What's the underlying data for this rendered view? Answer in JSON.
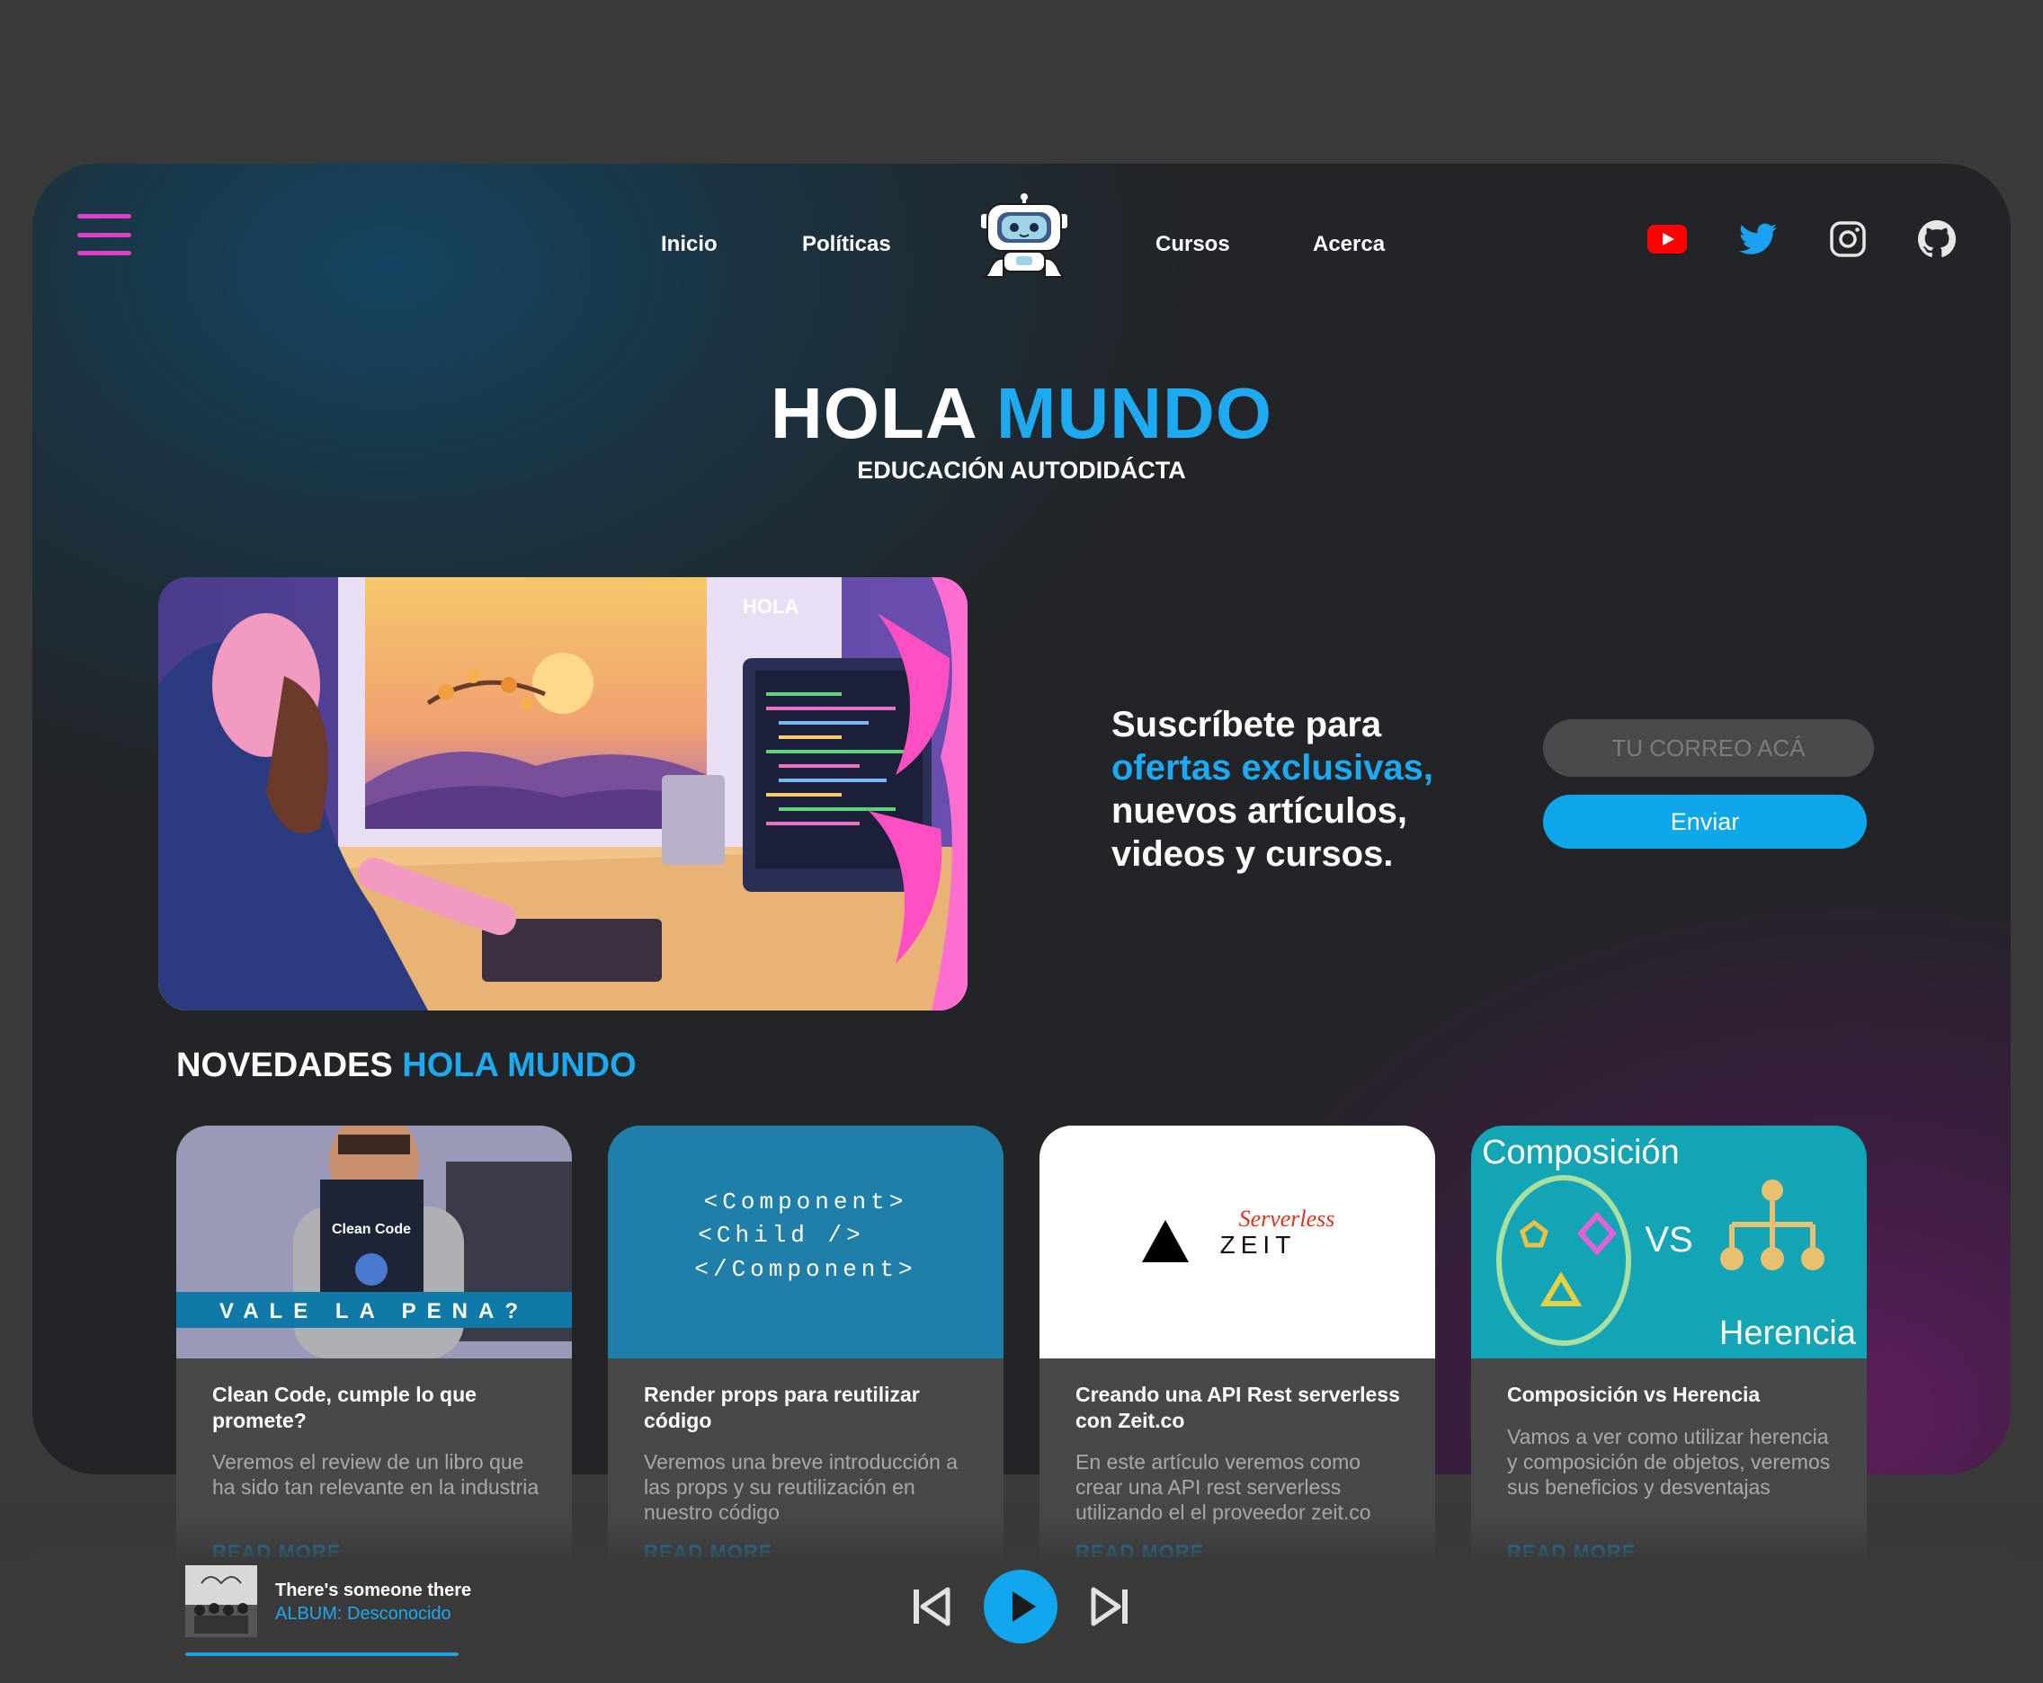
{
  "nav": {
    "items": [
      "Inicio",
      "Políticas",
      "Cursos",
      "Acerca"
    ],
    "social": [
      "youtube-icon",
      "twitter-icon",
      "instagram-icon",
      "github-icon"
    ]
  },
  "hero": {
    "title_part1": "HOLA",
    "title_part2": "MUNDO",
    "subtitle": "EDUCACIÓN AUTODIDÁCTA"
  },
  "illustration": {
    "brand_mark": "HOLA"
  },
  "subscribe": {
    "line1": "Suscríbete para",
    "line2": "ofertas exclusivas,",
    "line3": "nuevos artículos,",
    "line4": "videos y cursos.",
    "placeholder": "TU CORREO ACÁ",
    "button": "Enviar"
  },
  "news": {
    "title_part1": "NOVEDADES",
    "title_part2": "HOLA MUNDO",
    "cards": [
      {
        "title": "Clean Code, cumple lo que promete?",
        "desc": "Veremos el review de un libro que ha sido tan relevante en la industria",
        "more": "READ MORE",
        "img_book": "Clean Code",
        "img_banner": "VALE LA PENA?"
      },
      {
        "title": "Render props para reutilizar código",
        "desc": "Veremos una breve introducción a las props y su reutilización en nuestro código",
        "more": "READ MORE",
        "img_lines": [
          "<Component>",
          "<Child />",
          "</Component>"
        ]
      },
      {
        "title": "Creando una API Rest serverless con Zeit.co",
        "desc": "En este artículo veremos como crear una API rest serverless utilizando el el proveedor zeit.co",
        "more": "READ MORE",
        "img_top": "Serverless",
        "img_brand": "ZEIT"
      },
      {
        "title": "Composición vs Herencia",
        "desc": "Vamos a ver como utilizar herencia y composición de objetos, veremos sus beneficios y desventajas",
        "more": "READ MORE",
        "img_left": "Composición",
        "img_vs": "VS",
        "img_right": "Herencia"
      }
    ]
  },
  "player": {
    "song": "There's someone there",
    "album": "ALBUM: Desconocido",
    "progress": 1.0
  },
  "colors": {
    "accent": "#1eaaf0",
    "menu": "#e040c8",
    "background": "#3a3a3a"
  }
}
